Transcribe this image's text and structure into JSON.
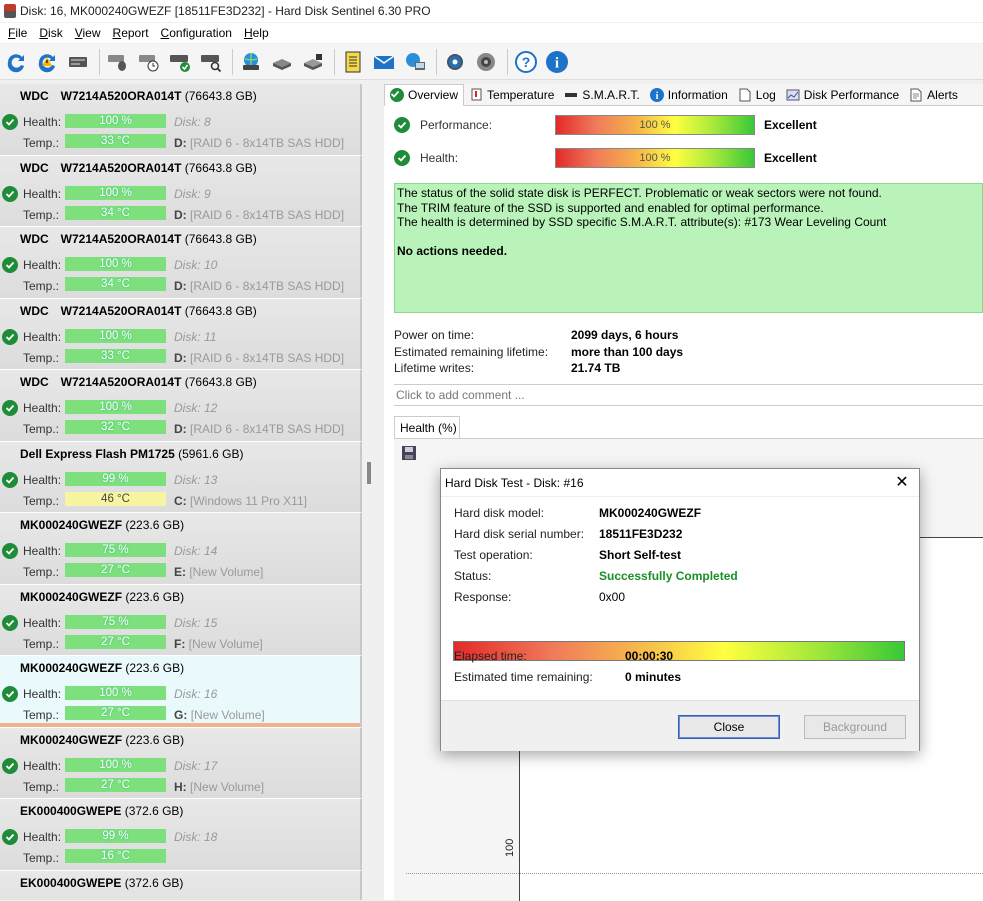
{
  "window": {
    "title": "Disk: 16, MK000240GWEZF [18511FE3D232]  -  Hard Disk Sentinel 6.30 PRO"
  },
  "menu": [
    "File",
    "Disk",
    "View",
    "Report",
    "Configuration",
    "Help"
  ],
  "toolbar": [
    "refresh-icon",
    "alert-icon",
    "disk-icon",
    "disk-mouse-icon",
    "disk-clock-icon",
    "disk-check-icon",
    "disk-search-icon",
    "globe-disk-icon",
    "disk-tools-icon",
    "disk-settings-icon",
    "report-icon",
    "mail-icon",
    "network-icon",
    "gear-icon",
    "speaker-icon",
    "help-icon",
    "info-icon"
  ],
  "disk_labels": {
    "health": "Health:",
    "temp": "Temp.:"
  },
  "disks": [
    {
      "vendor": "WDC",
      "model": "W7214A520ORA014T",
      "size": "(76643.8 GB)",
      "health": "100 %",
      "temp": "33 °C",
      "disk": "Disk: 8",
      "drive": "D:",
      "volume": "[RAID 6 - 8x14TB SAS HDD]",
      "warm": false,
      "selected": false
    },
    {
      "vendor": "WDC",
      "model": "W7214A520ORA014T",
      "size": "(76643.8 GB)",
      "health": "100 %",
      "temp": "34 °C",
      "disk": "Disk: 9",
      "drive": "D:",
      "volume": "[RAID 6 - 8x14TB SAS HDD]",
      "warm": false,
      "selected": false
    },
    {
      "vendor": "WDC",
      "model": "W7214A520ORA014T",
      "size": "(76643.8 GB)",
      "health": "100 %",
      "temp": "34 °C",
      "disk": "Disk: 10",
      "drive": "D:",
      "volume": "[RAID 6 - 8x14TB SAS HDD]",
      "warm": false,
      "selected": false
    },
    {
      "vendor": "WDC",
      "model": "W7214A520ORA014T",
      "size": "(76643.8 GB)",
      "health": "100 %",
      "temp": "33 °C",
      "disk": "Disk: 11",
      "drive": "D:",
      "volume": "[RAID 6 - 8x14TB SAS HDD]",
      "warm": false,
      "selected": false
    },
    {
      "vendor": "WDC",
      "model": "W7214A520ORA014T",
      "size": "(76643.8 GB)",
      "health": "100 %",
      "temp": "32 °C",
      "disk": "Disk: 12",
      "drive": "D:",
      "volume": "[RAID 6 - 8x14TB SAS HDD]",
      "warm": false,
      "selected": false
    },
    {
      "vendor": "Dell Express Flash PM1725",
      "model": "",
      "size": "(5961.6 GB)",
      "health": "99 %",
      "temp": "46 °C",
      "disk": "Disk: 13",
      "drive": "C:",
      "volume": "[Windows 11 Pro X11]",
      "warm": true,
      "selected": false
    },
    {
      "vendor": "MK000240GWEZF",
      "model": "",
      "size": "(223.6 GB)",
      "health": "75 %",
      "temp": "27 °C",
      "disk": "Disk: 14",
      "drive": "E:",
      "volume": "[New Volume]",
      "warm": false,
      "selected": false
    },
    {
      "vendor": "MK000240GWEZF",
      "model": "",
      "size": "(223.6 GB)",
      "health": "75 %",
      "temp": "27 °C",
      "disk": "Disk: 15",
      "drive": "F:",
      "volume": "[New Volume]",
      "warm": false,
      "selected": false
    },
    {
      "vendor": "MK000240GWEZF",
      "model": "",
      "size": "(223.6 GB)",
      "health": "100 %",
      "temp": "27 °C",
      "disk": "Disk: 16",
      "drive": "G:",
      "volume": "[New Volume]",
      "warm": false,
      "selected": true
    },
    {
      "vendor": "MK000240GWEZF",
      "model": "",
      "size": "(223.6 GB)",
      "health": "100 %",
      "temp": "27 °C",
      "disk": "Disk: 17",
      "drive": "H:",
      "volume": "[New Volume]",
      "warm": false,
      "selected": false
    },
    {
      "vendor": "EK000400GWEPE",
      "model": "",
      "size": "(372.6 GB)",
      "health": "99 %",
      "temp": "16 °C",
      "disk": "Disk: 18",
      "drive": "",
      "volume": "",
      "warm": false,
      "selected": false
    },
    {
      "vendor": "EK000400GWEPE",
      "model": "",
      "size": "(372.6 GB)",
      "health": "",
      "temp": "",
      "disk": "",
      "drive": "",
      "volume": "",
      "warm": false,
      "selected": false
    }
  ],
  "tabs": [
    {
      "label": "Overview",
      "icon": "check-icon",
      "active": true
    },
    {
      "label": "Temperature",
      "icon": "thermometer-icon",
      "active": false
    },
    {
      "label": "S.M.A.R.T.",
      "icon": "disk-icon",
      "active": false
    },
    {
      "label": "Information",
      "icon": "info-icon",
      "active": false
    },
    {
      "label": "Log",
      "icon": "document-icon",
      "active": false
    },
    {
      "label": "Disk Performance",
      "icon": "chart-icon",
      "active": false
    },
    {
      "label": "Alerts",
      "icon": "alert-doc-icon",
      "active": false
    }
  ],
  "overview": {
    "performance": {
      "label": "Performance:",
      "value": "100 %",
      "level": 1.0,
      "rating": "Excellent"
    },
    "health": {
      "label": "Health:",
      "value": "100 %",
      "level": 1.0,
      "rating": "Excellent"
    },
    "status_lines": [
      "The status of the solid state disk is PERFECT. Problematic or weak sectors were not found.",
      "The TRIM feature of the SSD is supported and enabled for optimal performance.",
      "The health is determined by SSD specific S.M.A.R.T. attribute(s):  #173 Wear Leveling Count"
    ],
    "actions": "No actions needed.",
    "power_on_label": "Power on time:",
    "power_on": "2099 days, 6 hours",
    "lifetime_label": "Estimated remaining lifetime:",
    "lifetime": "more than 100 days",
    "writes_label": "Lifetime writes:",
    "writes": "21.74 TB",
    "comment_placeholder": "Click to add comment ...",
    "health_tab": "Health (%)",
    "chart_tick": "100"
  },
  "dialog": {
    "title": "Hard Disk Test - Disk: #16",
    "model_label": "Hard disk model:",
    "model": "MK000240GWEZF",
    "serial_label": "Hard disk serial number:",
    "serial": "18511FE3D232",
    "op_label": "Test operation:",
    "op": "Short Self-test",
    "status_label": "Status:",
    "status": "Successfully Completed",
    "response_label": "Response:",
    "response": "0x00",
    "progress": 1.0,
    "elapsed_label": "Elapsed time:",
    "elapsed": "00:00:30",
    "remaining_label": "Estimated time remaining:",
    "remaining": "0 minutes",
    "close_label": "Close",
    "background_label": "Background"
  }
}
